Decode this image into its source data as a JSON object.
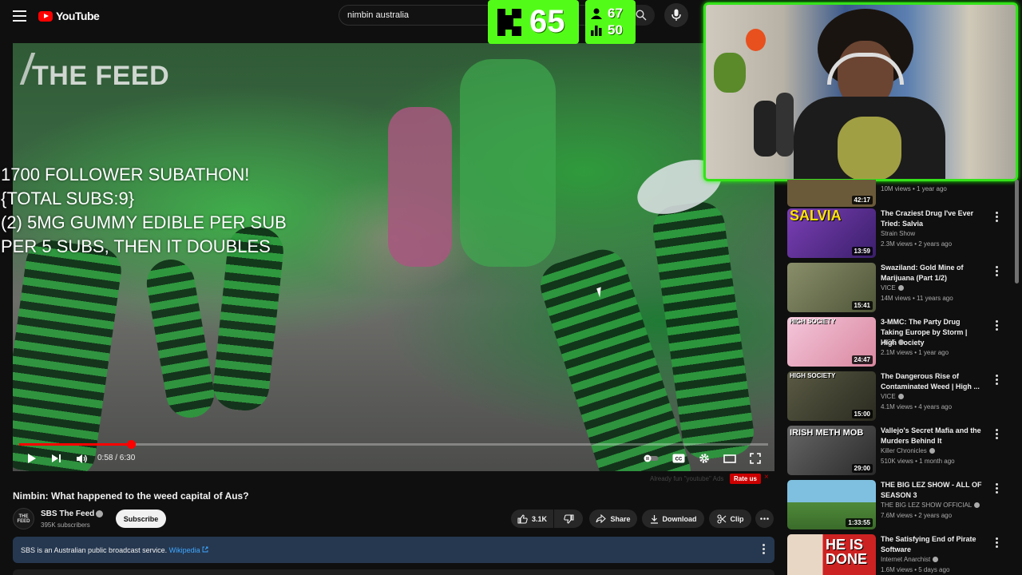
{
  "header": {
    "logo_text": "YouTube",
    "search_value": "nimbin australia",
    "search_placeholder": "Search"
  },
  "kick_overlay": {
    "count": "65",
    "stat_followers": "67",
    "stat_subs": "50",
    "accent_color": "#53fc18"
  },
  "subathon_overlay": {
    "line1": "1700 FOLLOWER SUBATHON!",
    "line2": "{TOTAL SUBS:9}",
    "line3": "(2) 5MG GUMMY EDIBLE PER SUB",
    "line4": "PER 5 SUBS, THEN IT DOUBLES"
  },
  "player": {
    "watermark": "THE FEED",
    "time_current": "0:58",
    "time_total": "6:30",
    "time_display": "0:58 / 6:30",
    "progress_fraction": 0.149,
    "progress_color": "#ff0000"
  },
  "video": {
    "title": "Nimbin: What happened to the weed capital of Aus?",
    "channel_name": "SBS The Feed",
    "channel_avatar_text": "THE FEED",
    "subscribers": "395K subscribers",
    "subscribe_label": "Subscribe",
    "likes": "3.1K",
    "share_label": "Share",
    "download_label": "Download",
    "clip_label": "Clip"
  },
  "rating_bar": {
    "note": "Already fun \"youtube\" Ads",
    "rate_label": "Rate us",
    "close_label": "×"
  },
  "info_bar": {
    "text": "SBS is an Australian public broadcast service.",
    "link": "Wikipedia"
  },
  "sidebar": {
    "items": [
      {
        "title": "",
        "channel": "",
        "meta": "10M views • 1 year ago",
        "duration": "42:17",
        "thumb_label": "",
        "thumb_color": "#6b5a3a"
      },
      {
        "title": "The Craziest Drug I've Ever Tried: Salvia",
        "channel": "Strain Show",
        "verified": false,
        "meta": "2.3M views • 2 years ago",
        "duration": "13:59",
        "thumb_label": "SALVIA",
        "thumb_color": "#7b3fb5"
      },
      {
        "title": "Swaziland: Gold Mine of Marijuana (Part 1/2)",
        "channel": "VICE",
        "verified": true,
        "meta": "14M views • 11 years ago",
        "duration": "15:41",
        "thumb_label": "",
        "thumb_color": "#6b7052"
      },
      {
        "title": "3-MMC: The Party Drug Taking Europe by Storm | High Society",
        "channel": "VICE",
        "verified": true,
        "meta": "2.1M views • 1 year ago",
        "duration": "24:47",
        "thumb_label": "HIGH SOCIETY",
        "thumb_color": "#e9a7c4"
      },
      {
        "title": "The Dangerous Rise of Contaminated Weed | High ...",
        "channel": "VICE",
        "verified": true,
        "meta": "4.1M views • 4 years ago",
        "duration": "15:00",
        "thumb_label": "HIGH SOCIETY",
        "thumb_color": "#3a3a2e"
      },
      {
        "title": "Vallejo's Secret Mafia and the Murders Behind It",
        "channel": "Killer Chronicles",
        "verified": true,
        "meta": "510K views • 1 month ago",
        "duration": "29:00",
        "thumb_label": "IRISH METH MOB",
        "thumb_color": "#4a4a4a"
      },
      {
        "title": "THE BIG LEZ SHOW - ALL OF SEASON 3",
        "channel": "THE BIG LEZ SHOW OFFICIAL",
        "verified": true,
        "meta": "7.6M views • 2 years ago",
        "duration": "1:33:55",
        "thumb_label": "",
        "thumb_color": "#4f8a3a"
      },
      {
        "title": "The Satisfying End of Pirate Software",
        "channel": "Internet Anarchist",
        "verified": true,
        "meta": "1.6M views • 5 days ago",
        "duration": "",
        "thumb_label": "HE IS DONE",
        "thumb_color": "#e8d7c5"
      }
    ]
  }
}
